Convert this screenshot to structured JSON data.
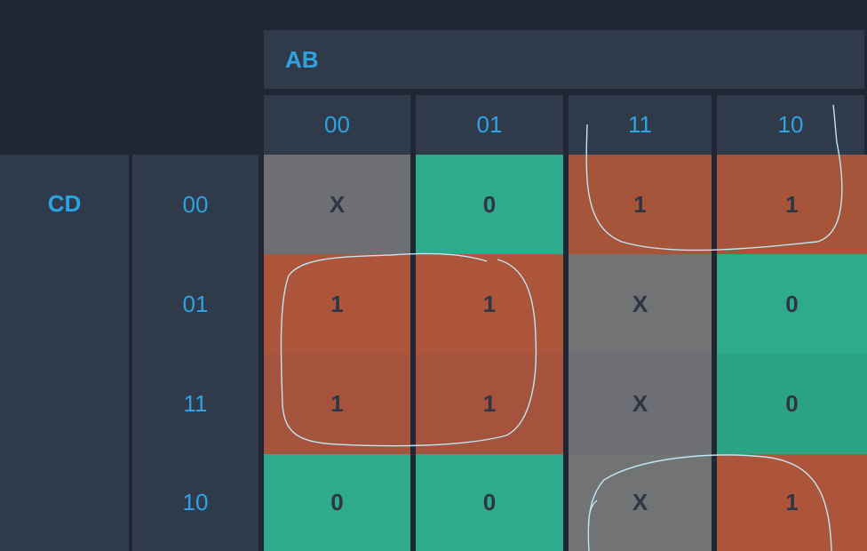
{
  "map": {
    "col_var": "AB",
    "row_var": "CD",
    "col_headers": [
      "00",
      "01",
      "11",
      "10"
    ],
    "row_headers": [
      "00",
      "01",
      "11",
      "10"
    ],
    "cells": [
      [
        "X",
        "0",
        "1",
        "1"
      ],
      [
        "1",
        "1",
        "X",
        "0"
      ],
      [
        "1",
        "1",
        "X",
        "0"
      ],
      [
        "0",
        "0",
        "X",
        "1"
      ]
    ]
  },
  "colors": {
    "one": "#a6553b",
    "zero": "#2eaa8c",
    "dont_care": "#6e6f74",
    "header": "#2f3a4a",
    "label": "#2ea3e3",
    "group_outline": "#bfe6f2"
  }
}
